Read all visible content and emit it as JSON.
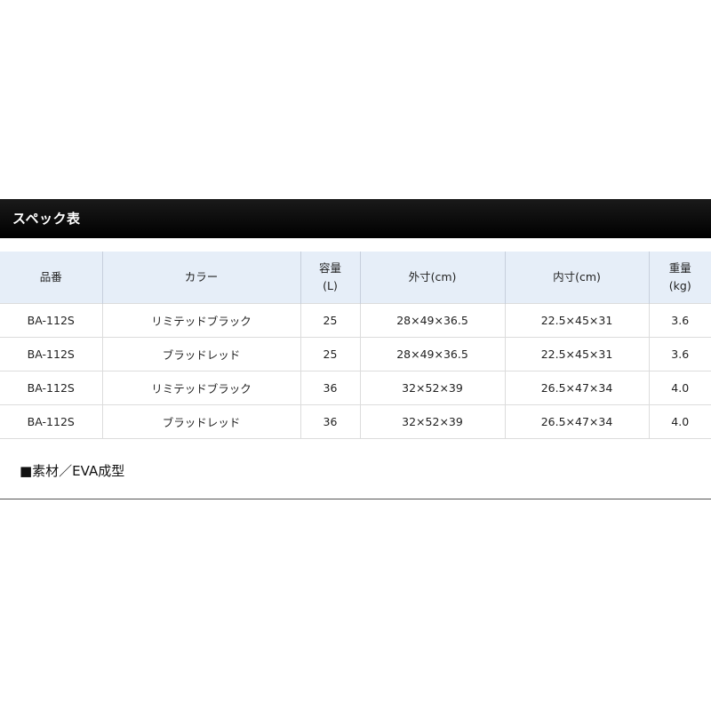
{
  "section": {
    "title": "スペック表"
  },
  "table": {
    "headers": [
      {
        "line1": "品番",
        "line2": ""
      },
      {
        "line1": "カラー",
        "line2": ""
      },
      {
        "line1": "容量",
        "line2": "(L)"
      },
      {
        "line1": "外寸(cm)",
        "line2": ""
      },
      {
        "line1": "内寸(cm)",
        "line2": ""
      },
      {
        "line1": "重量",
        "line2": "(kg)"
      }
    ],
    "rows": [
      [
        "BA-112S",
        "リミテッドブラック",
        "25",
        "28×49×36.5",
        "22.5×45×31",
        "3.6"
      ],
      [
        "BA-112S",
        "ブラッドレッド",
        "25",
        "28×49×36.5",
        "22.5×45×31",
        "3.6"
      ],
      [
        "BA-112S",
        "リミテッドブラック",
        "36",
        "32×52×39",
        "26.5×47×34",
        "4.0"
      ],
      [
        "BA-112S",
        "ブラッドレッド",
        "36",
        "32×52×39",
        "26.5×47×34",
        "4.0"
      ]
    ]
  },
  "note": {
    "material": "■素材／EVA成型"
  }
}
